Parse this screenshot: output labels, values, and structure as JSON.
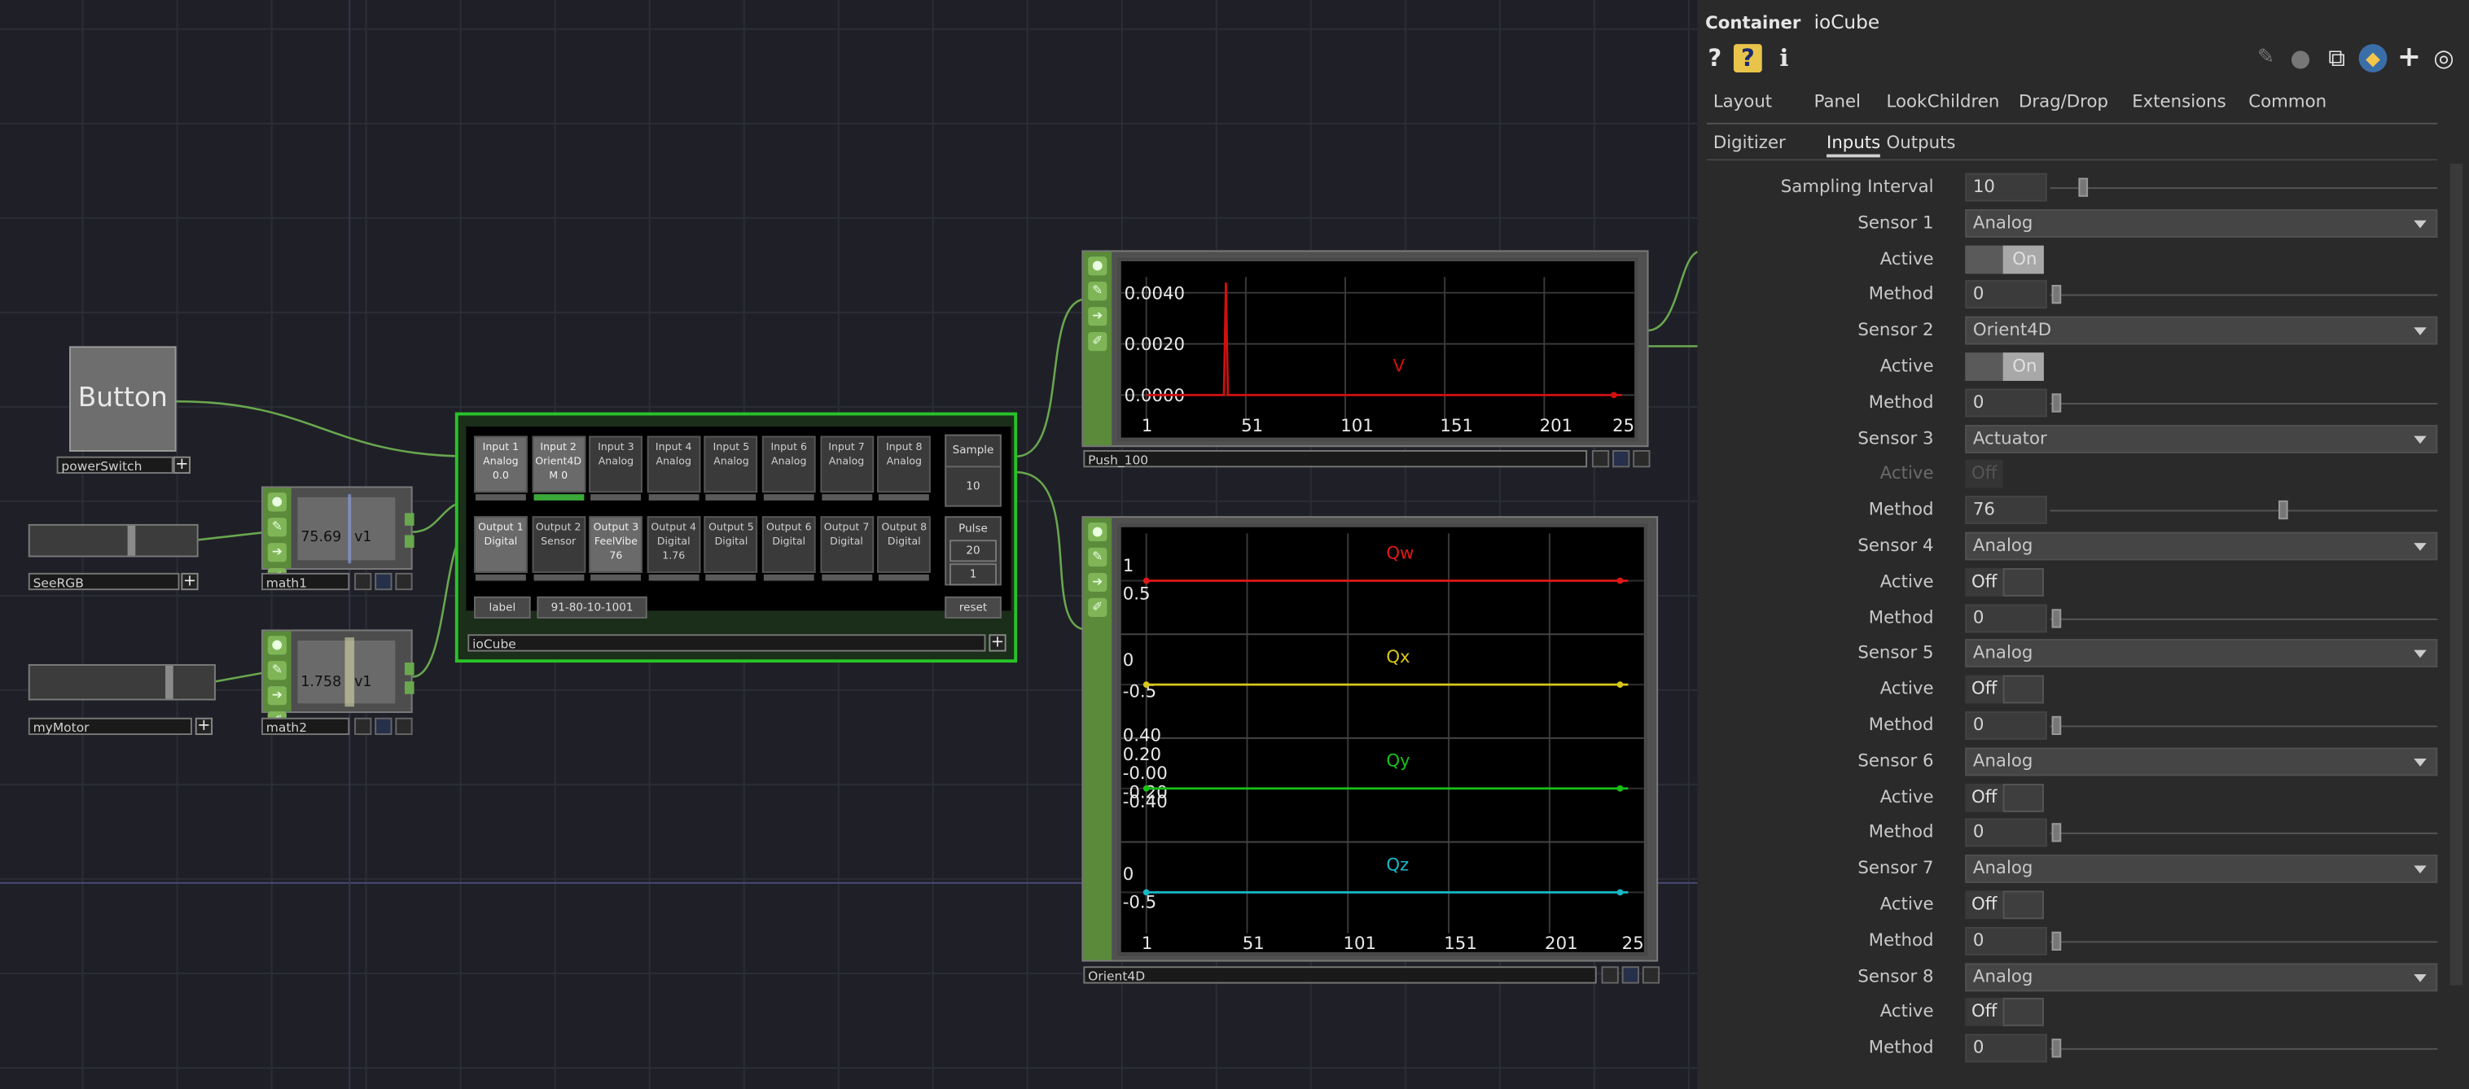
{
  "network": {
    "button_op": {
      "text": "Button",
      "name": "powerSwitch"
    },
    "slider_rgb": {
      "name": "SeeRGB"
    },
    "slider_motor": {
      "name": "myMotor"
    },
    "math1": {
      "name": "math1",
      "value": "75.69",
      "channel": "v1"
    },
    "math2": {
      "name": "math2",
      "value": "1.758",
      "channel": "v1"
    },
    "iocube": {
      "name": "ioCube",
      "inputs": [
        {
          "l1": "Input 1",
          "l2": "Analog",
          "l3": "0.0"
        },
        {
          "l1": "Input 2",
          "l2": "Orient4D",
          "l3": "M 0"
        },
        {
          "l1": "Input 3",
          "l2": "Analog",
          "l3": ""
        },
        {
          "l1": "Input 4",
          "l2": "Analog",
          "l3": ""
        },
        {
          "l1": "Input 5",
          "l2": "Analog",
          "l3": ""
        },
        {
          "l1": "Input 6",
          "l2": "Analog",
          "l3": ""
        },
        {
          "l1": "Input 7",
          "l2": "Analog",
          "l3": ""
        },
        {
          "l1": "Input 8",
          "l2": "Analog",
          "l3": ""
        }
      ],
      "outputs": [
        {
          "l1": "Output 1",
          "l2": "Digital",
          "l3": ""
        },
        {
          "l1": "Output 2",
          "l2": "Sensor",
          "l3": ""
        },
        {
          "l1": "Output 3",
          "l2": "FeelVibe",
          "l3": "76"
        },
        {
          "l1": "Output 4",
          "l2": "Digital",
          "l3": "1.76"
        },
        {
          "l1": "Output 5",
          "l2": "Digital",
          "l3": ""
        },
        {
          "l1": "Output 6",
          "l2": "Digital",
          "l3": ""
        },
        {
          "l1": "Output 7",
          "l2": "Digital",
          "l3": ""
        },
        {
          "l1": "Output 8",
          "l2": "Digital",
          "l3": ""
        }
      ],
      "sample_label": "Sample",
      "sample_value": "10",
      "pulse_label": "Pulse",
      "pulse_value": "20",
      "pulse_value2": "1",
      "label_btn": "label",
      "id_text": "91-80-10-1001",
      "reset_btn": "reset"
    },
    "push_chart": {
      "name": "Push_100",
      "y_ticks": [
        "0.0040",
        "0.0020",
        "0.0000"
      ],
      "x_ticks": [
        "1",
        "51",
        "101",
        "151",
        "201",
        "25"
      ],
      "series_label": "V"
    },
    "orient_chart": {
      "name": "Orient4D",
      "x_ticks": [
        "1",
        "51",
        "101",
        "151",
        "201",
        "25"
      ],
      "bands": [
        {
          "label": "Qw",
          "ticks": [
            "1",
            "0.5"
          ],
          "color": "#e01818"
        },
        {
          "label": "Qx",
          "ticks": [
            "0",
            "-0.5"
          ],
          "color": "#d8c818"
        },
        {
          "label": "Qy",
          "ticks": [
            "0.40",
            "0.20",
            "-0.00",
            "-0.20",
            "-0.40"
          ],
          "color": "#18c018"
        },
        {
          "label": "Qz",
          "ticks": [
            "0",
            "-0.5"
          ],
          "color": "#18b8c8"
        }
      ]
    }
  },
  "chart_data": [
    {
      "type": "line",
      "title": "",
      "x_tick_labels": [
        1,
        51,
        101,
        151,
        201,
        25
      ],
      "y_tick_labels": [
        0.004,
        0.002,
        0.0
      ],
      "series": [
        {
          "name": "V",
          "color": "#d01010",
          "points": [
            [
              1,
              0
            ],
            [
              40,
              0
            ],
            [
              41,
              0.0044
            ],
            [
              42,
              0
            ],
            [
              240,
              0
            ]
          ]
        }
      ]
    },
    {
      "type": "line",
      "title": "",
      "x_tick_labels": [
        1,
        51,
        101,
        151,
        201,
        25
      ],
      "series": [
        {
          "name": "Qw",
          "color": "#e01818",
          "value": 1.0
        },
        {
          "name": "Qx",
          "color": "#d8c818",
          "value": 0.0
        },
        {
          "name": "Qy",
          "color": "#18c018",
          "value": 0.0
        },
        {
          "name": "Qz",
          "color": "#18b8c8",
          "value": 0.0
        }
      ]
    }
  ],
  "panel": {
    "type_label": "Container",
    "comp_name": "ioCube",
    "icons": {
      "help": "?",
      "help_py": "?",
      "info": "i",
      "plus": "+"
    },
    "tabs1": [
      "Layout",
      "Panel",
      "Look",
      "Children",
      "Drag/Drop",
      "Extensions",
      "Common"
    ],
    "tabs2": [
      "Digitizer",
      "Inputs",
      "Outputs"
    ],
    "active_tab2": "Inputs",
    "params": [
      {
        "label": "Sampling Interval",
        "kind": "num",
        "value": "10",
        "slider": 0.07
      },
      {
        "label": "Sensor 1",
        "kind": "menu",
        "value": "Analog"
      },
      {
        "label": "Active",
        "kind": "toggle",
        "value": "On"
      },
      {
        "label": "Method",
        "kind": "num",
        "value": "0",
        "slider": 0.0
      },
      {
        "label": "Sensor 2",
        "kind": "menu",
        "value": "Orient4D"
      },
      {
        "label": "Active",
        "kind": "toggle",
        "value": "On"
      },
      {
        "label": "Method",
        "kind": "num",
        "value": "0",
        "slider": 0.0
      },
      {
        "label": "Sensor 3",
        "kind": "menu",
        "value": "Actuator"
      },
      {
        "label": "Active",
        "kind": "toggle-dim",
        "value": "Off"
      },
      {
        "label": "Method",
        "kind": "num",
        "value": "76",
        "slider": 0.6
      },
      {
        "label": "Sensor 4",
        "kind": "menu",
        "value": "Analog"
      },
      {
        "label": "Active",
        "kind": "toggle-off",
        "value": "Off"
      },
      {
        "label": "Method",
        "kind": "num",
        "value": "0",
        "slider": 0.0
      },
      {
        "label": "Sensor 5",
        "kind": "menu",
        "value": "Analog"
      },
      {
        "label": "Active",
        "kind": "toggle-off",
        "value": "Off"
      },
      {
        "label": "Method",
        "kind": "num",
        "value": "0",
        "slider": 0.0
      },
      {
        "label": "Sensor 6",
        "kind": "menu",
        "value": "Analog"
      },
      {
        "label": "Active",
        "kind": "toggle-off",
        "value": "Off"
      },
      {
        "label": "Method",
        "kind": "num",
        "value": "0",
        "slider": 0.0
      },
      {
        "label": "Sensor 7",
        "kind": "menu",
        "value": "Analog"
      },
      {
        "label": "Active",
        "kind": "toggle-off",
        "value": "Off"
      },
      {
        "label": "Method",
        "kind": "num",
        "value": "0",
        "slider": 0.0
      },
      {
        "label": "Sensor 8",
        "kind": "menu",
        "value": "Analog"
      },
      {
        "label": "Active",
        "kind": "toggle-off",
        "value": "Off"
      },
      {
        "label": "Method",
        "kind": "num",
        "value": "0",
        "slider": 0.0
      }
    ]
  }
}
